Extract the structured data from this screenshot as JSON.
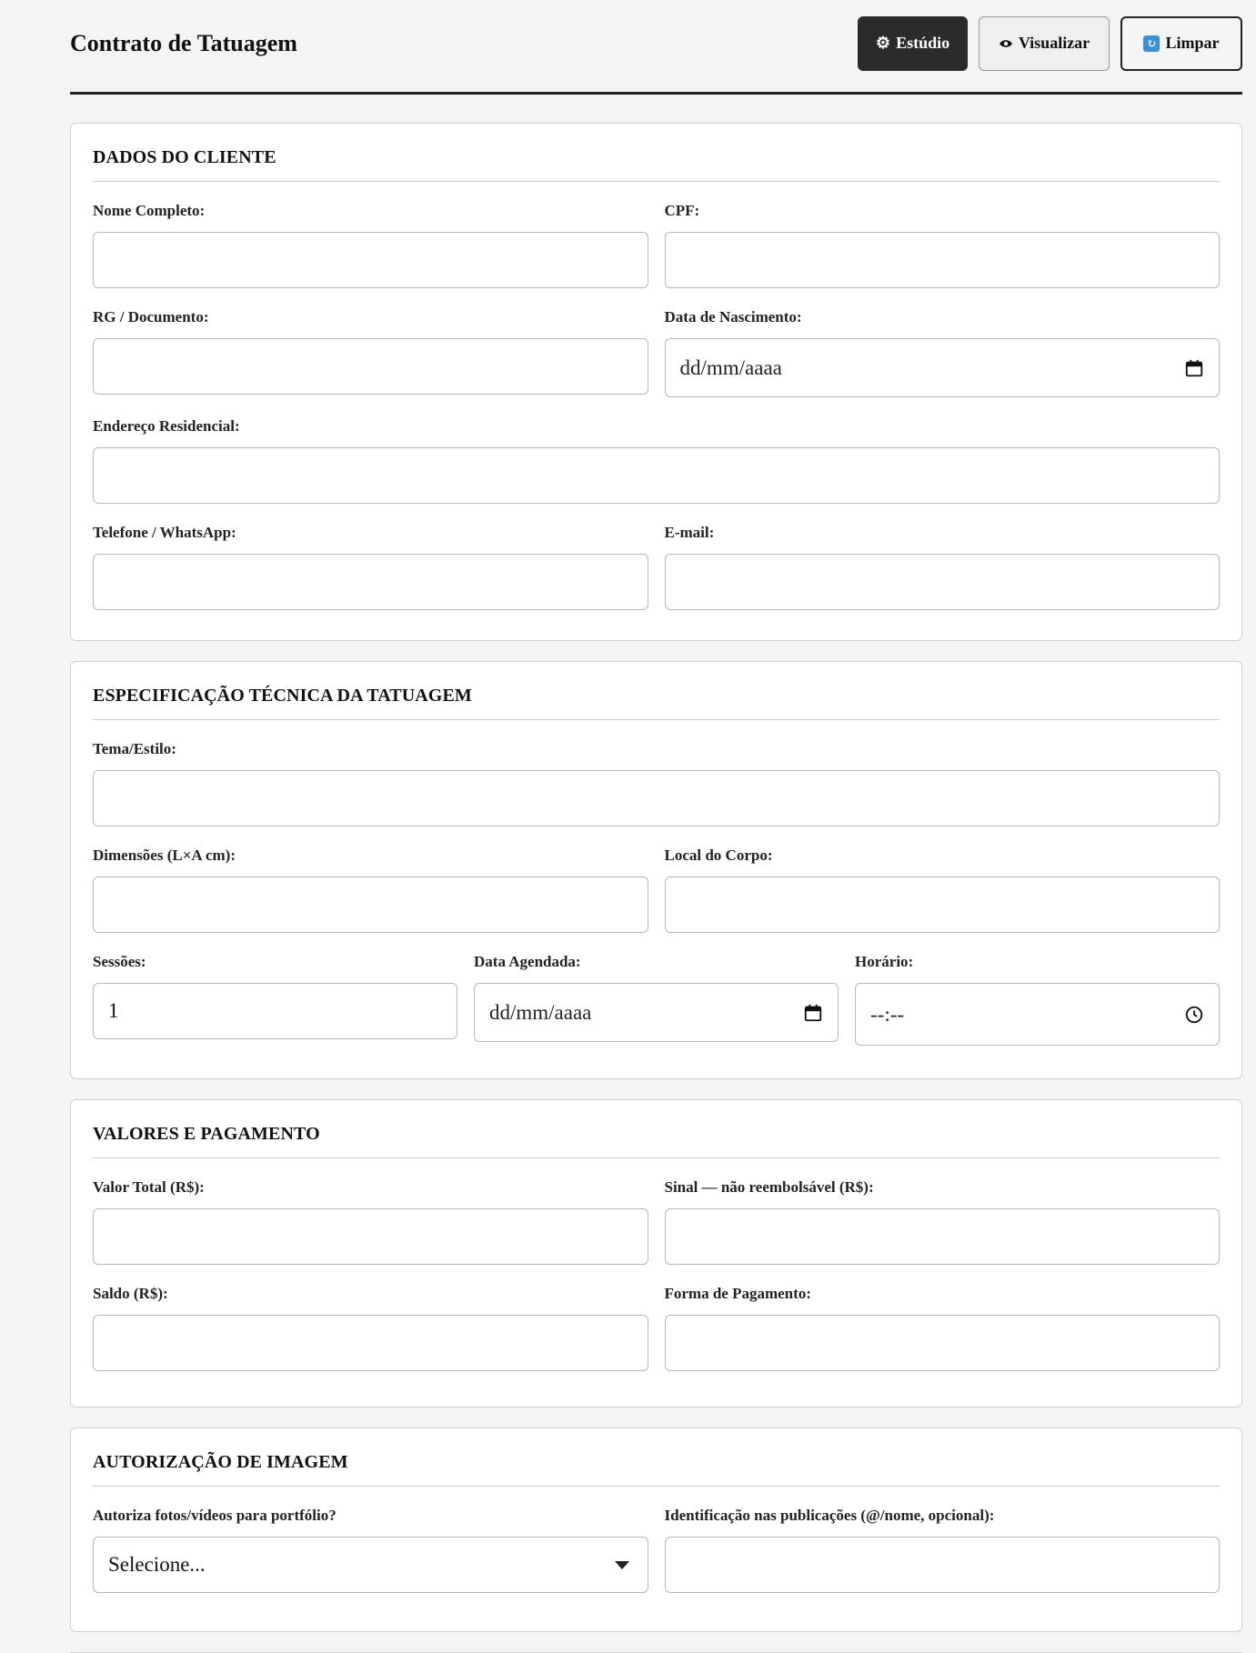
{
  "header": {
    "title": "Contrato de Tatuagem",
    "buttons": {
      "studio": "Estúdio",
      "preview": "Visualizar",
      "clear": "Limpar"
    }
  },
  "sections": {
    "cliente": {
      "title": "DADOS DO CLIENTE",
      "nome": {
        "label": "Nome Completo:",
        "value": ""
      },
      "cpf": {
        "label": "CPF:",
        "value": ""
      },
      "rg": {
        "label": "RG / Documento:",
        "value": ""
      },
      "nascimento": {
        "label": "Data de Nascimento:",
        "value": "dd/mm/aaaa"
      },
      "endereco": {
        "label": "Endereço Residencial:",
        "value": ""
      },
      "telefone": {
        "label": "Telefone / WhatsApp:",
        "value": ""
      },
      "email": {
        "label": "E-mail:",
        "value": ""
      }
    },
    "tatuagem": {
      "title": "ESPECIFICAÇÃO TÉCNICA DA TATUAGEM",
      "tema": {
        "label": "Tema/Estilo:",
        "value": ""
      },
      "dimensoes": {
        "label": "Dimensões (L×A cm):",
        "value": ""
      },
      "local": {
        "label": "Local do Corpo:",
        "value": ""
      },
      "sessoes": {
        "label": "Sessões:",
        "value": "1"
      },
      "data": {
        "label": "Data Agendada:",
        "value": "dd/mm/aaaa"
      },
      "horario": {
        "label": "Horário:",
        "value": "--:--"
      }
    },
    "valores": {
      "title": "VALORES E PAGAMENTO",
      "total": {
        "label": "Valor Total (R$):",
        "value": ""
      },
      "sinal": {
        "label": "Sinal — não reembolsável (R$):",
        "value": ""
      },
      "saldo": {
        "label": "Saldo (R$):",
        "value": ""
      },
      "forma": {
        "label": "Forma de Pagamento:",
        "value": ""
      }
    },
    "imagem": {
      "title": "AUTORIZAÇÃO DE IMAGEM",
      "autoriza": {
        "label": "Autoriza fotos/vídeos para portfólio?",
        "value": "Selecione..."
      },
      "identificacao": {
        "label": "Identificação nas publicações (@/nome, opcional):",
        "value": ""
      }
    }
  },
  "icons": {
    "studio": "gear-icon",
    "preview": "eye-icon",
    "clear": "refresh-icon",
    "date": "calendar-icon",
    "time": "clock-icon",
    "select": "chevron-down-icon"
  },
  "colors": {
    "background": "#f4f4f4",
    "primary_button": "#2b2b2b",
    "refresh_icon": "#3b8fe0"
  }
}
